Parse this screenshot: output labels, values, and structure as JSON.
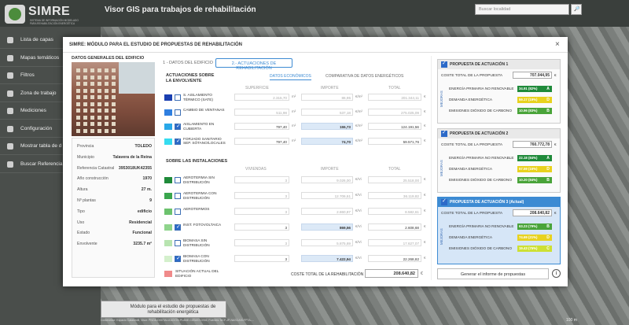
{
  "app": {
    "logo_title": "SIMRE",
    "logo_subtitle": "SISTEMA DE INFORMACIÓN MODELADO PARA REHABILITACIÓN ENERGÉTICA",
    "title": "Visor GIS para trabajos de rehabilitación",
    "search_placeholder": "Buscar localidad"
  },
  "sidebar": {
    "items": [
      {
        "label": "Lista de capas",
        "icon": "layers-icon"
      },
      {
        "label": "Mapas temáticos",
        "icon": "map-icon"
      },
      {
        "label": "Filtros",
        "icon": "filter-icon"
      },
      {
        "label": "Zona de trabajo",
        "icon": "work-zone-icon"
      },
      {
        "label": "Mediciones",
        "icon": "ruler-icon"
      },
      {
        "label": "Configuración",
        "icon": "gear-icon"
      },
      {
        "label": "Mostrar tabla de d",
        "icon": "table-icon"
      },
      {
        "label": "Buscar Referencia C",
        "icon": "search-icon"
      }
    ]
  },
  "map": {
    "bottom_label": "Módulo para el estudio de propuestas de rehabilitación energética",
    "attribution": "Contenedor: Espacio CatastroB, Visor: PNOA-DIGITALIZACIÓN-PLANE-CIEMAT-OSM, Fuentes: NCF-JP-NASCASI-FPTA-...",
    "scale": "100 m"
  },
  "modal": {
    "title": "SIMRE: MÓDULO PARA EL ESTUDIO DE PROPUESTAS DE REHABILITACIÓN",
    "close": "×",
    "left_title": "DATOS GENERALES DEL EDIFICIO",
    "info": [
      {
        "key": "Provincia",
        "value": "TOLEDO"
      },
      {
        "key": "Municipio",
        "value": "Talavera de la Reina"
      },
      {
        "key": "Referencia Catastral",
        "value": "3953018UK42355"
      },
      {
        "key": "Año construcción",
        "value": "1970"
      },
      {
        "key": "Altura",
        "value": "27 m."
      },
      {
        "key": "Nº plantas",
        "value": "9"
      },
      {
        "key": "Tipo",
        "value": "edificio"
      },
      {
        "key": "Uso",
        "value": "Residencial"
      },
      {
        "key": "Estado",
        "value": "Funcional"
      },
      {
        "key": "Envolvente",
        "value": "3235.7 m²"
      }
    ],
    "tabs": [
      "1 - DATOS DEL EDIFICIO",
      "2.- ACTUACIONES DE REHABILITACIÓN"
    ],
    "subtabs": [
      "DATOS ECONÓMICOS",
      "COMPARATIVA DE DATOS ENERGÉTICOS"
    ],
    "envelope_head": "ACTUACIONES SOBRE LA ENVOLVENTE",
    "env_cols": [
      "SUPERFICIE",
      "IMPORTE",
      "TOTAL"
    ],
    "envelope": [
      {
        "label": "S. AISLAMIENTO TÉRMICO (SATE)",
        "color": "#1a3fb0",
        "checked": false,
        "superficie": "2.315,70",
        "importe": "86,95",
        "total": "201.344,11",
        "active": false
      },
      {
        "label": "CAMBIO DE VENTANAS",
        "color": "#2f7fe0",
        "checked": false,
        "superficie": "511,98",
        "importe": "537,18",
        "total": "275.025,09",
        "active": false
      },
      {
        "label": "AISLAMIENTO EN CUBIERTA",
        "color": "#29a8e8",
        "checked": true,
        "superficie": "797,40",
        "importe": "155,73",
        "total": "124.191,56",
        "active": true
      },
      {
        "label": "FORJADO SANITARIO SEP. SÓTANO/LOCALES",
        "color": "#35dcf0",
        "checked": true,
        "superficie": "797,40",
        "importe": "74,70",
        "total": "59.571,76",
        "active": true
      }
    ],
    "install_head": "SOBRE LAS INSTALACIONES",
    "inst_cols": [
      "VIVIENDAS",
      "IMPORTE",
      "TOTAL"
    ],
    "installations": [
      {
        "label": "AEROTERMIA SIN DISTRIBUCIÓN",
        "color": "#1f8a3a",
        "checked": false,
        "viviendas": "3",
        "importe": "9.026,00",
        "total": "25.518,00",
        "active": false
      },
      {
        "label": "AEROTERMIA CON DISTRIBUCIÓN",
        "color": "#3aa64e",
        "checked": false,
        "viviendas": "3",
        "importe": "12.706,61",
        "total": "36.119,82",
        "active": false
      },
      {
        "label": "AEROTERMOS",
        "color": "#6cc26d",
        "checked": false,
        "viviendas": "3",
        "importe": "2.860,87",
        "total": "8.582,61",
        "active": false
      },
      {
        "label": "INST. FOTOVOLTAICA",
        "color": "#8fd48c",
        "checked": true,
        "viviendas": "3",
        "importe": "869,56",
        "total": "2.608,68",
        "active": true
      },
      {
        "label": "BIOMASA SIN DISTRIBUCIÓN",
        "color": "#b8e4b0",
        "checked": false,
        "viviendas": "3",
        "importe": "5.875,69",
        "total": "17.627,07",
        "active": false
      },
      {
        "label": "BIOMASA CON DISTRIBUCIÓN",
        "color": "#d4f0cc",
        "checked": true,
        "viviendas": "3",
        "importe": "7.422,94",
        "total": "22.268,82",
        "active": true
      }
    ],
    "current_label": "SITUACIÓN ACTUAL DEL EDIFICIO",
    "current_color": "#f08a8a",
    "total_label": "COSTE TOTAL DE LA REHABILITACIÓN",
    "total_value": "208.640,82",
    "currency": "€",
    "unit_m2": "m²",
    "unit_e_m2": "€/m²",
    "unit_e_viv": "€/Vi",
    "report_button": "Generar el informe de propuestas",
    "info_icon": "i",
    "mejoras": "MEJORAS",
    "proposals": [
      {
        "title": "PROPUESTA DE ACTUACIÓN 1",
        "cost_label": "COSTE TOTAL DE LA PROPUESTA",
        "cost": "707.044,95",
        "active": false,
        "indicators": [
          {
            "label": "ENERGÍA PRIMARIA NO RENOVABLE",
            "value": "34.91 (82%)",
            "grade": "A",
            "color": "#1f8a3a"
          },
          {
            "label": "DEMANDA ENERGÉTICA",
            "value": "59.17 (19%)",
            "grade": "D",
            "color": "#e8d21f"
          },
          {
            "label": "EMISIONES DIÓXIDO DE CARBONO",
            "value": "10.96 (83%)",
            "grade": "B",
            "color": "#4aa43a"
          }
        ]
      },
      {
        "title": "PROPUESTA DE ACTUACIÓN 2",
        "cost_label": "COSTE TOTAL DE LA PROPUESTA",
        "cost": "760.772,78",
        "active": false,
        "indicators": [
          {
            "label": "ENERGÍA PRIMARIA NO RENOVABLE",
            "value": "22.18 (84%)",
            "grade": "A",
            "color": "#1f8a3a"
          },
          {
            "label": "DEMANDA ENERGÉTICA",
            "value": "57.59 (16%)",
            "grade": "D",
            "color": "#e8d21f"
          },
          {
            "label": "EMISIONES DIÓXIDO DE CARBONO",
            "value": "10.20 (84%)",
            "grade": "B",
            "color": "#4aa43a"
          }
        ]
      },
      {
        "title": "PROPUESTA DE ACTUACIÓN 3 (Actual)",
        "cost_label": "COSTE TOTAL DE LA PROPUESTA",
        "cost": "208.640,82",
        "active": true,
        "indicators": [
          {
            "label": "ENERGÍA PRIMARIA NO RENOVABLE",
            "value": "63.23 (79%)",
            "grade": "B",
            "color": "#4aa43a"
          },
          {
            "label": "DEMANDA ENERGÉTICA",
            "value": "74.69 (21%)",
            "grade": "D",
            "color": "#e8d21f"
          },
          {
            "label": "EMISIONES DIÓXIDO DE CARBONO",
            "value": "19.43 (75%)",
            "grade": "C",
            "color": "#cde034"
          }
        ]
      }
    ]
  }
}
